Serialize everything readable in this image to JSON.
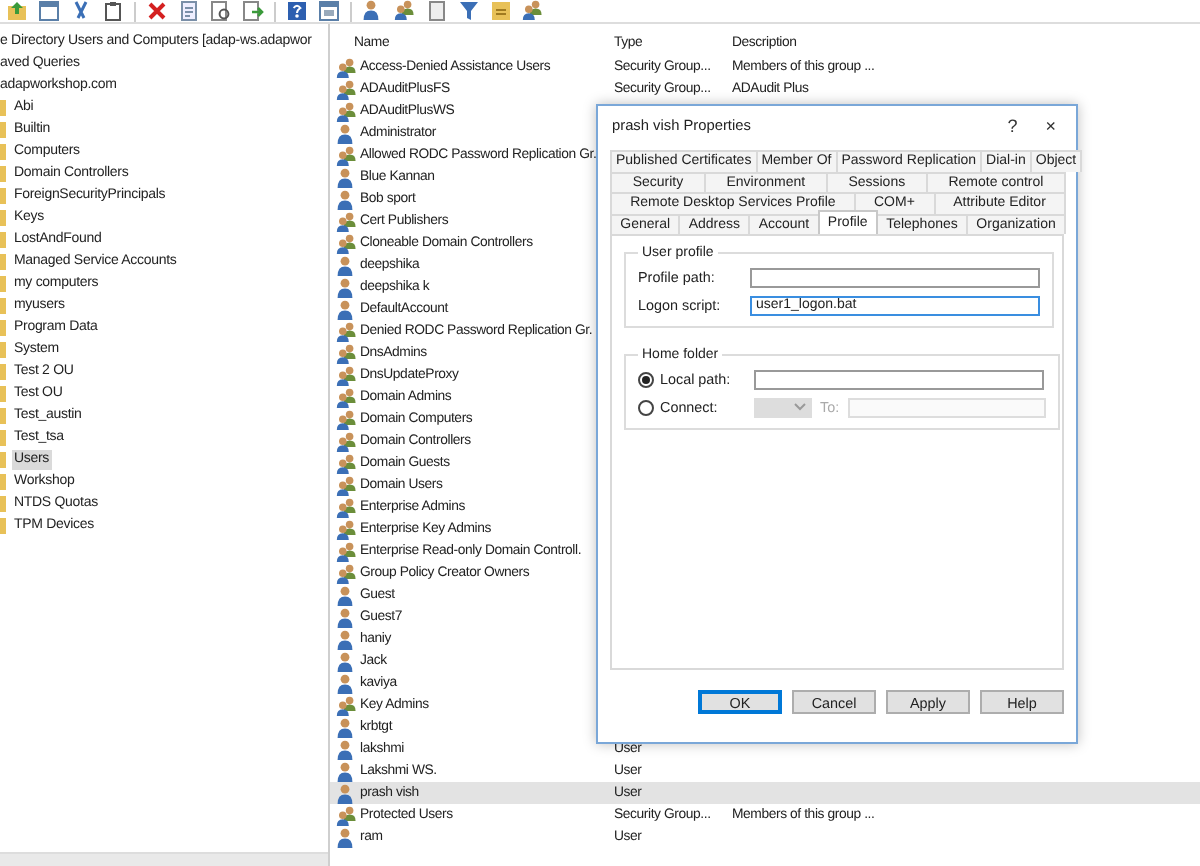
{
  "tree": {
    "title": "e Directory Users and Computers [adap-ws.adapwor",
    "saved_queries": "aved Queries",
    "domain": "adapworkshop.com",
    "children": [
      {
        "label": "Abi",
        "selected": false
      },
      {
        "label": "Builtin",
        "selected": false
      },
      {
        "label": "Computers",
        "selected": false
      },
      {
        "label": "Domain Controllers",
        "selected": false
      },
      {
        "label": "ForeignSecurityPrincipals",
        "selected": false
      },
      {
        "label": "Keys",
        "selected": false
      },
      {
        "label": "LostAndFound",
        "selected": false
      },
      {
        "label": "Managed Service Accounts",
        "selected": false
      },
      {
        "label": "my computers",
        "selected": false
      },
      {
        "label": "myusers",
        "selected": false
      },
      {
        "label": "Program Data",
        "selected": false
      },
      {
        "label": "System",
        "selected": false
      },
      {
        "label": "Test 2 OU",
        "selected": false
      },
      {
        "label": "Test OU",
        "selected": false
      },
      {
        "label": "Test_austin",
        "selected": false
      },
      {
        "label": "Test_tsa",
        "selected": false
      },
      {
        "label": "Users",
        "selected": true
      },
      {
        "label": "Workshop",
        "selected": false
      },
      {
        "label": "NTDS Quotas",
        "selected": false
      },
      {
        "label": "TPM Devices",
        "selected": false
      }
    ]
  },
  "list": {
    "columns": [
      "Name",
      "Type",
      "Description"
    ],
    "rows": [
      {
        "name": "Access-Denied Assistance Users",
        "kind": "group",
        "type": "Security Group...",
        "description": "Members of this group ...",
        "selected": false
      },
      {
        "name": "ADAuditPlusFS",
        "kind": "group",
        "type": "Security Group...",
        "description": "ADAudit Plus",
        "selected": false
      },
      {
        "name": "ADAuditPlusWS",
        "kind": "group",
        "selected": false
      },
      {
        "name": "Administrator",
        "kind": "user",
        "selected": false
      },
      {
        "name": "Allowed RODC Password Replication Gr.",
        "kind": "group",
        "selected": false
      },
      {
        "name": "Blue Kannan",
        "kind": "user",
        "selected": false
      },
      {
        "name": "Bob sport",
        "kind": "user",
        "selected": false
      },
      {
        "name": "Cert Publishers",
        "kind": "group",
        "selected": false
      },
      {
        "name": "Cloneable Domain Controllers",
        "kind": "group",
        "selected": false
      },
      {
        "name": "deepshika",
        "kind": "user",
        "selected": false
      },
      {
        "name": "deepshika k",
        "kind": "user",
        "selected": false
      },
      {
        "name": "DefaultAccount",
        "kind": "user",
        "selected": false
      },
      {
        "name": "Denied RODC Password Replication Gr.",
        "kind": "group",
        "selected": false
      },
      {
        "name": "DnsAdmins",
        "kind": "group",
        "selected": false
      },
      {
        "name": "DnsUpdateProxy",
        "kind": "group",
        "selected": false
      },
      {
        "name": "Domain Admins",
        "kind": "group",
        "selected": false
      },
      {
        "name": "Domain Computers",
        "kind": "group",
        "selected": false
      },
      {
        "name": "Domain Controllers",
        "kind": "group",
        "selected": false
      },
      {
        "name": "Domain Guests",
        "kind": "group",
        "selected": false
      },
      {
        "name": "Domain Users",
        "kind": "group",
        "selected": false
      },
      {
        "name": "Enterprise Admins",
        "kind": "group",
        "selected": false
      },
      {
        "name": "Enterprise Key Admins",
        "kind": "group",
        "selected": false
      },
      {
        "name": "Enterprise Read-only Domain Controll.",
        "kind": "group",
        "selected": false
      },
      {
        "name": "Group Policy Creator Owners",
        "kind": "group",
        "selected": false
      },
      {
        "name": "Guest",
        "kind": "user",
        "selected": false
      },
      {
        "name": "Guest7",
        "kind": "user",
        "selected": false
      },
      {
        "name": "haniy",
        "kind": "user",
        "selected": false
      },
      {
        "name": "Jack",
        "kind": "user",
        "selected": false
      },
      {
        "name": "kaviya",
        "kind": "user",
        "selected": false
      },
      {
        "name": "Key Admins",
        "kind": "group",
        "selected": false
      },
      {
        "name": "krbtgt",
        "kind": "user",
        "selected": false
      },
      {
        "name": "lakshmi",
        "kind": "user",
        "type": "User",
        "selected": false
      },
      {
        "name": "Lakshmi WS.",
        "kind": "user",
        "type": "User",
        "selected": false
      },
      {
        "name": "prash vish",
        "kind": "user",
        "type": "User",
        "selected": true
      },
      {
        "name": "Protected Users",
        "kind": "group",
        "type": "Security Group...",
        "description": "Members of this group ...",
        "selected": false
      },
      {
        "name": "ram",
        "kind": "user",
        "type": "User",
        "selected": false
      }
    ]
  },
  "dialog": {
    "title": "prash vish Properties",
    "help": "?",
    "close": "×",
    "tab_rows": [
      [
        {
          "label": "Published Certificates",
          "selected": false
        },
        {
          "label": "Member Of",
          "selected": false
        },
        {
          "label": "Password Replication",
          "selected": false
        },
        {
          "label": "Dial-in",
          "selected": false
        },
        {
          "label": "Object",
          "selected": false
        }
      ],
      [
        {
          "label": "Security",
          "selected": false
        },
        {
          "label": "Environment",
          "selected": false
        },
        {
          "label": "Sessions",
          "selected": false
        },
        {
          "label": "Remote control",
          "selected": false
        }
      ],
      [
        {
          "label": "Remote Desktop Services Profile",
          "selected": false
        },
        {
          "label": "COM+",
          "selected": false
        },
        {
          "label": "Attribute Editor",
          "selected": false
        }
      ],
      [
        {
          "label": "General",
          "selected": false
        },
        {
          "label": "Address",
          "selected": false
        },
        {
          "label": "Account",
          "selected": false
        },
        {
          "label": "Profile",
          "selected": true
        },
        {
          "label": "Telephones",
          "selected": false
        },
        {
          "label": "Organization",
          "selected": false
        }
      ]
    ],
    "user_profile": {
      "title": "User profile",
      "fields": [
        {
          "label": "Profile path:",
          "focused": false
        },
        {
          "label": "Logon script:",
          "value": "user1_logon.bat",
          "focused": true
        }
      ]
    },
    "home_folder": {
      "title": "Home folder",
      "options": [
        {
          "label": "Local path:",
          "selected": true
        },
        {
          "label": "Connect:",
          "selected": false
        }
      ],
      "to_label": "To:",
      "disabled": true
    },
    "buttons": [
      {
        "label": "OK",
        "default": true
      },
      {
        "label": "Cancel",
        "default": false
      },
      {
        "label": "Apply",
        "default": false
      },
      {
        "label": "Help",
        "default": false
      }
    ]
  }
}
